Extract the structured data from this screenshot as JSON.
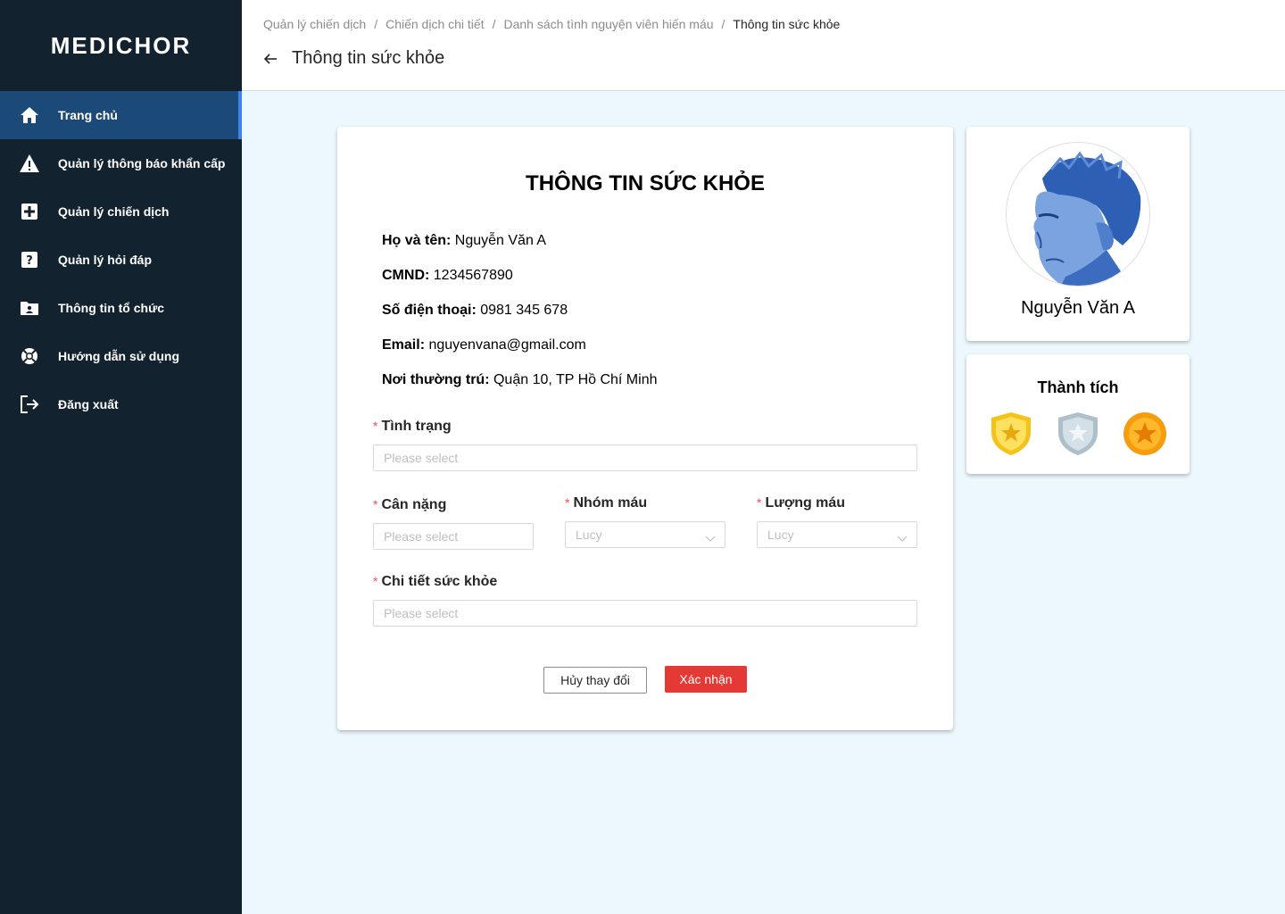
{
  "app": {
    "logo": "MEDICHOR"
  },
  "sidebar": {
    "items": [
      {
        "label": "Trang chủ",
        "icon": "home-icon",
        "active": true
      },
      {
        "label": "Quản lý thông báo khẩn cấp",
        "icon": "warning-icon"
      },
      {
        "label": "Quản lý chiến dịch",
        "icon": "medical-cross-icon"
      },
      {
        "label": "Quản lý hỏi đáp",
        "icon": "question-icon"
      },
      {
        "label": "Thông tin tổ chức",
        "icon": "folder-user-icon"
      },
      {
        "label": "Hướng dẫn sử dụng",
        "icon": "lifebuoy-icon"
      },
      {
        "label": "Đăng xuất",
        "icon": "logout-icon"
      }
    ]
  },
  "header": {
    "breadcrumb": [
      "Quản lý chiến dịch",
      "Chiến dịch chi tiết",
      "Danh sách tình nguyện viên hiến máu",
      "Thông tin sức khỏe"
    ],
    "separator": "/",
    "title": "Thông tin sức khỏe"
  },
  "form": {
    "title": "THÔNG TIN SỨC KHỎE",
    "info": [
      {
        "label": "Họ và tên:",
        "value": " Nguyễn Văn A"
      },
      {
        "label": "CMND:",
        "value": " 1234567890"
      },
      {
        "label": "Số điện thoại:",
        "value": " 0981 345 678"
      },
      {
        "label": "Email:",
        "value": " nguyenvana@gmail.com"
      },
      {
        "label": "Nơi thường trú:",
        "value": " Quận 10, TP Hồ Chí Minh"
      }
    ],
    "required_mark": "*",
    "status": {
      "label": "Tình trạng",
      "placeholder": "Please select"
    },
    "weight": {
      "label": "Cân nặng",
      "placeholder": "Please select"
    },
    "blood_type": {
      "label": "Nhóm máu",
      "value": "Lucy"
    },
    "blood_amount": {
      "label": "Lượng máu",
      "value": "Lucy"
    },
    "health_detail": {
      "label": "Chi tiết sức khỏe",
      "placeholder": "Please select"
    },
    "cancel_label": "Hủy thay đổi",
    "confirm_label": "Xác nhận"
  },
  "profile": {
    "name": "Nguyễn Văn A"
  },
  "achievements": {
    "title": "Thành tích",
    "medals": [
      "gold-shield-medal-icon",
      "silver-shield-medal-icon",
      "gold-coin-medal-icon"
    ]
  },
  "colors": {
    "sidebar": "#13222f",
    "active": "#1b4a78",
    "accent": "#3b82f6",
    "danger": "#e53935",
    "background": "#ecf8fd"
  }
}
